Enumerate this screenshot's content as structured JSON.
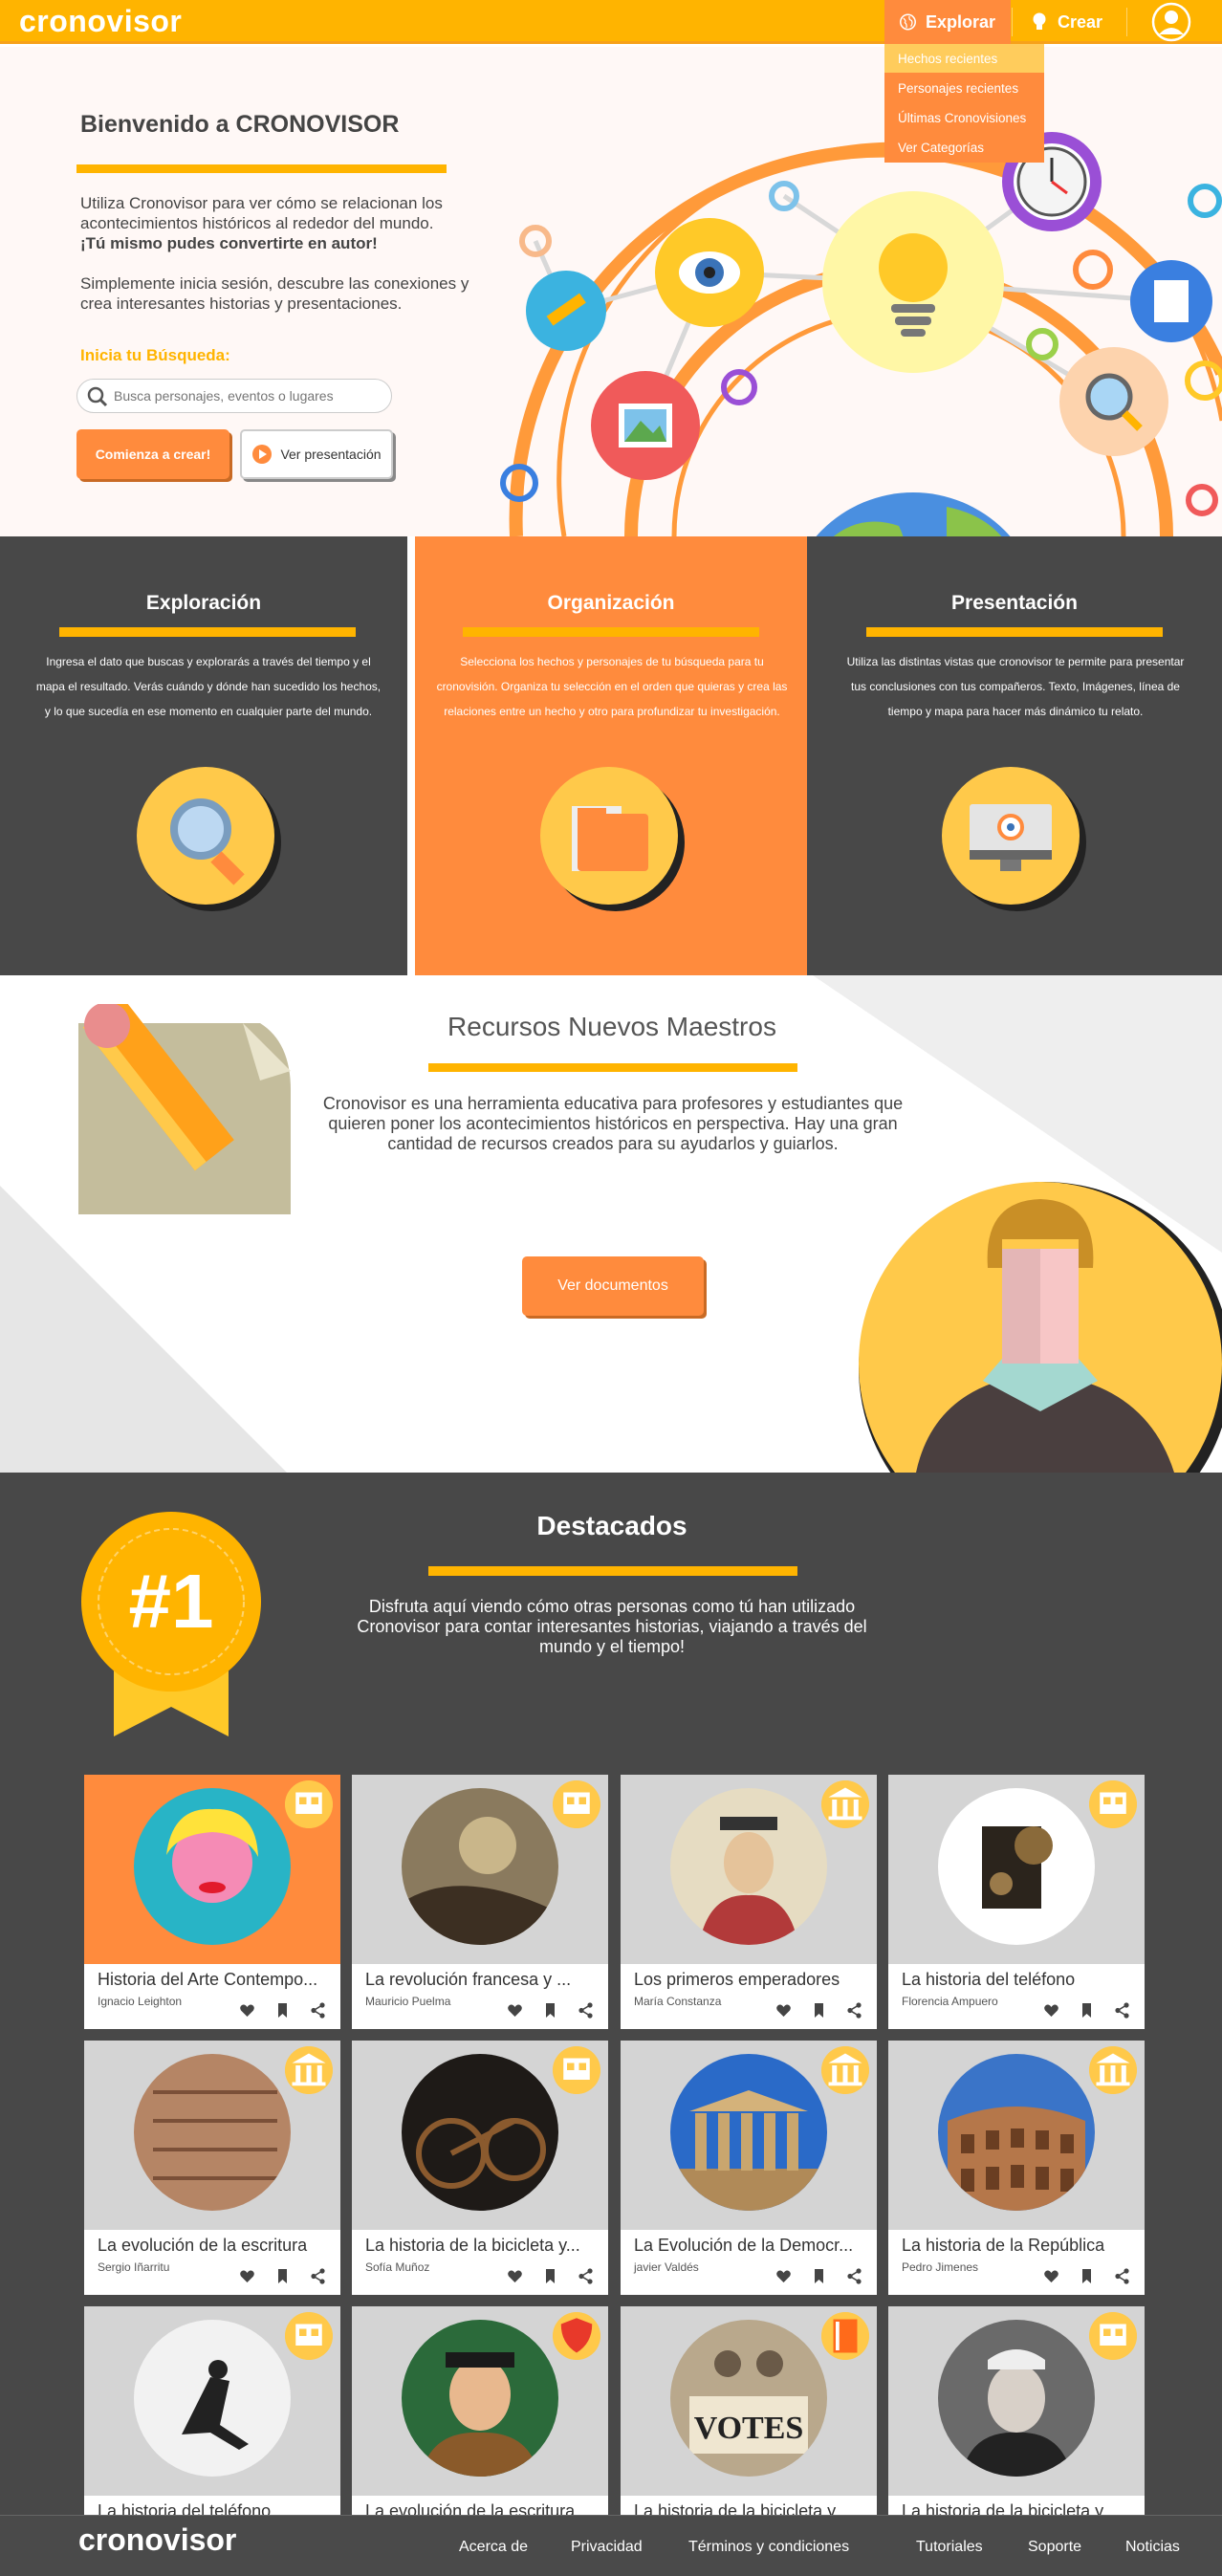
{
  "header": {
    "logo": "cronovisor",
    "nav": {
      "explorar": "Explorar",
      "crear": "Crear"
    },
    "dropdown": [
      "Hechos recientes",
      "Personajes recientes",
      "Últimas Cronovisiones",
      "Ver Categorías"
    ]
  },
  "hero": {
    "title": "Bienvenido a CRONOVISOR",
    "p1a": "Utiliza Cronovisor para ver cómo se relacionan los acontecimientos históricos al rededor del mundo.",
    "p1b": "¡Tú mismo pudes convertirte en autor!",
    "p2": "Simplemente inicia sesión, descubre las conexiones y crea interesantes historias y presentaciones.",
    "search_label": "Inicia tu Búsqueda:",
    "search_placeholder": "Busca personajes, eventos o lugares",
    "btn_crear": "Comienza a crear!",
    "btn_present": "Ver presentación"
  },
  "features": [
    {
      "title": "Exploración",
      "text": "Ingresa el dato que buscas y explorarás a través del tiempo y el mapa el resultado. Verás cuándo y dónde han sucedido los hechos, y lo que sucedía en ese momento en cualquier parte del mundo.",
      "icon": "magnifier-icon"
    },
    {
      "title": "Organización",
      "text": "Selecciona los hechos y personajes de tu búsqueda para tu cronovisión. Organiza tu selección en el orden que quieras y crea las relaciones entre un hecho y otro para profundizar tu investigación.",
      "icon": "folder-icon"
    },
    {
      "title": "Presentación",
      "text": "Utiliza las distintas vistas que cronovisor te permite para presentar tus conclusiones con tus compañeros. Texto, Imágenes, línea de tiempo y mapa para hacer más dinámico tu relato.",
      "icon": "monitor-icon"
    }
  ],
  "recursos": {
    "title": "Recursos Nuevos Maestros",
    "text": "Cronovisor es una herramienta educativa para profesores y estudiantes que quieren poner los acontecimientos históricos en perspectiva. Hay una gran cantidad de recursos creados para su ayudarlos y guiarlos.",
    "button": "Ver documentos"
  },
  "destacados": {
    "title": "Destacados",
    "badge": "#1",
    "text": "Disfruta aquí viendo cómo otras personas como tú han utilizado Cronovisor para contar interesantes historias, viajando a través del mundo y el tiempo!",
    "cards": [
      {
        "title": "Historia del Arte Contempo...",
        "author": "Ignacio Leighton",
        "bg": "#ff8b3d",
        "img": "pop-art-portrait",
        "ribbon": "film-icon"
      },
      {
        "title": "La revolución francesa y ...",
        "author": "Mauricio Puelma",
        "bg": "#d4d4d4",
        "img": "painting-revolution",
        "ribbon": "film-icon"
      },
      {
        "title": "Los primeros emperadores",
        "author": "María Constanza",
        "bg": "#d4d4d4",
        "img": "emperor-portrait",
        "ribbon": "museum-icon"
      },
      {
        "title": "La historia del teléfono",
        "author": "Florencia Ampuero",
        "bg": "#d4d4d4",
        "img": "old-telephone",
        "ribbon": "film-icon"
      },
      {
        "title": "La evolución de la escritura",
        "author": "Sergio Iñarritu",
        "bg": "#d4d4d4",
        "img": "cuneiform-tablet",
        "ribbon": "museum-icon"
      },
      {
        "title": "La historia de la bicicleta y...",
        "author": "Sofía Muñoz",
        "bg": "#d4d4d4",
        "img": "wooden-bicycle",
        "ribbon": "film-icon"
      },
      {
        "title": "La Evolución de la Democr...",
        "author": "javier Valdés",
        "bg": "#d4d4d4",
        "img": "parthenon",
        "ribbon": "museum-icon"
      },
      {
        "title": "La historia de la República",
        "author": "Pedro Jimenes",
        "bg": "#d4d4d4",
        "img": "colosseum",
        "ribbon": "museum-icon"
      },
      {
        "title": "La historia del teléfono",
        "author": "",
        "bg": "#d4d4d4",
        "img": "soldier-photo",
        "ribbon": "film-icon"
      },
      {
        "title": "La evolución de la escritura",
        "author": "",
        "bg": "#d4d4d4",
        "img": "henry-viii-portrait",
        "ribbon": "shield-icon"
      },
      {
        "title": "La historia de la bicicleta y...",
        "author": "",
        "bg": "#d4d4d4",
        "img": "votes-for-women",
        "ribbon": "book-icon"
      },
      {
        "title": "La historia de la bicicleta y...",
        "author": "",
        "bg": "#d4d4d4",
        "img": "queen-victoria",
        "ribbon": "film-icon"
      }
    ]
  },
  "footer": {
    "logo": "cronovisor",
    "links": [
      "Acerca de",
      "Privacidad",
      "Términos y condiciones",
      "Tutoriales",
      "Soporte",
      "Noticias"
    ]
  },
  "colors": {
    "primary": "#ffb400",
    "accent": "#ff8b3d",
    "dark": "#484848"
  }
}
